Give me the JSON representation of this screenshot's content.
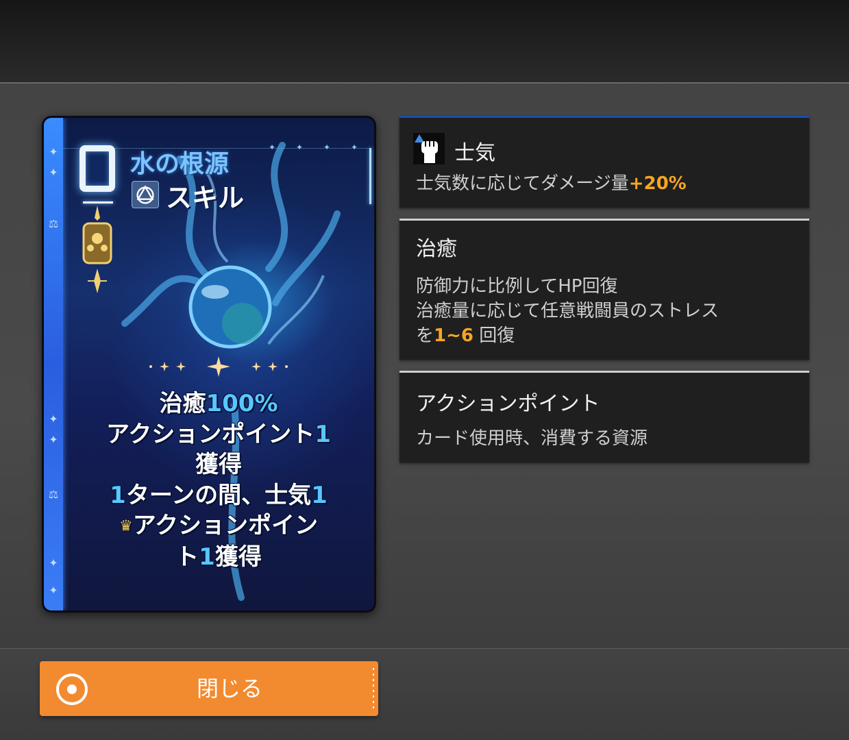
{
  "card": {
    "cost": "0",
    "name": "水の根源",
    "type": "スキル",
    "type_icon": "skill-triangle-icon",
    "effect_lines": [
      {
        "pre": "治癒",
        "hl": "100%",
        "post": ""
      },
      {
        "pre": "アクションポイント",
        "hl": "1",
        "post": ""
      },
      {
        "pre": "獲得",
        "hl": "",
        "post": ""
      },
      {
        "pre": "",
        "hl": "1",
        "post": "ターンの間、士気"
      },
      {
        "pre": "アクションポイン",
        "hl": "",
        "post": ""
      },
      {
        "pre": "ト",
        "hl": "1",
        "post": "獲得"
      }
    ],
    "colors": {
      "accent": "#58c7ff",
      "stripe": "#3a8cff",
      "name": "#7cc4ff"
    }
  },
  "keywords": [
    {
      "title": "士気",
      "icon": "fist-icon",
      "desc_pre": "士気数に応じてダメージ量",
      "desc_num": "+20%"
    },
    {
      "title": "治癒",
      "lines": [
        "防御力に比例してHP回復",
        "治癒量に応じて任意戦闘員のストレス"
      ],
      "last_pre": "を",
      "last_num": "1~6",
      "last_post": " 回復"
    },
    {
      "title": "アクションポイント",
      "desc": "カード使用時、消費する資源"
    }
  ],
  "close_button": {
    "label": "閉じる",
    "color": "#f28a30"
  }
}
